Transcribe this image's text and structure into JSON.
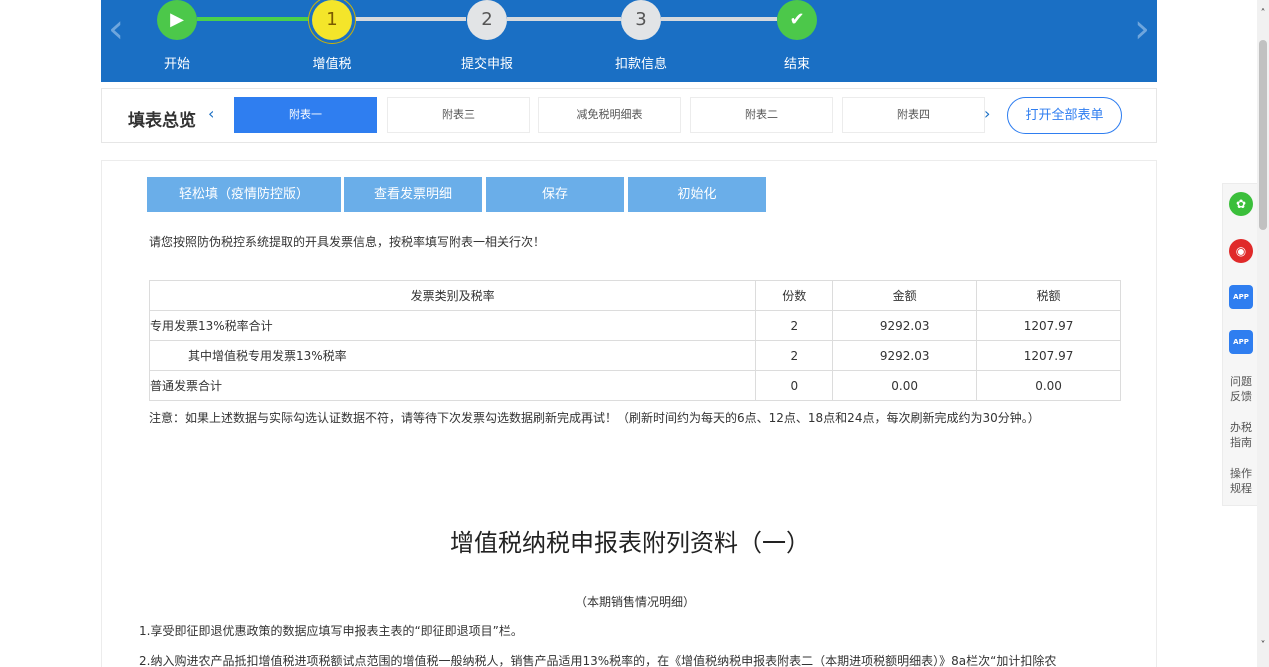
{
  "steps": [
    {
      "label": "开始",
      "marker": "▶",
      "status": "done"
    },
    {
      "label": "增值税",
      "marker": "1",
      "status": "current"
    },
    {
      "label": "提交申报",
      "marker": "2",
      "status": "pending"
    },
    {
      "label": "扣款信息",
      "marker": "3",
      "status": "pending"
    },
    {
      "label": "结束",
      "marker": "✔",
      "status": "done"
    }
  ],
  "nav": {
    "prev": "‹",
    "next": "›"
  },
  "tabs": {
    "title": "填表总览",
    "prev": "‹",
    "next": "›",
    "items": [
      "附表一",
      "附表三",
      "减免税明细表",
      "附表二",
      "附表四"
    ],
    "active_index": 0,
    "open_all": "打开全部表单"
  },
  "actions": [
    "轻松填（疫情防控版）",
    "查看发票明细",
    "保存",
    "初始化"
  ],
  "instruction": "请您按照防伪税控系统提取的开具发票信息，按税率填写附表一相关行次！",
  "table": {
    "headers": [
      "发票类别及税率",
      "份数",
      "金额",
      "税额"
    ],
    "rows": [
      {
        "category": "专用发票13%税率合计",
        "count": "2",
        "amount": "9292.03",
        "tax": "1207.97"
      },
      {
        "category": "其中增值税专用发票13%税率",
        "count": "2",
        "amount": "9292.03",
        "tax": "1207.97"
      },
      {
        "category": "普通发票合计",
        "count": "0",
        "amount": "0.00",
        "tax": "0.00"
      }
    ]
  },
  "note": "注意：如果上述数据与实际勾选认证数据不符，请等待下次发票勾选数据刷新完成再试！（刷新时间约为每天的6点、12点、18点和24点，每次刷新完成约为30分钟。）",
  "report": {
    "title": "增值税纳税申报表附列资料（一）",
    "subtitle": "（本期销售情况明细）",
    "rule_1": "1.享受即征即退优惠政策的数据应填写申报表主表的“即征即退项目”栏。",
    "rule_2": "2.纳入购进农产品抵扣增值税进项税额试点范围的增值税一般纳税人，销售产品适用13%税率的，在《增值税纳税申报表附表二（本期进项税额明细表）》8a栏次“加计扣除农"
  },
  "side_toolbar": {
    "icons": [
      "wechat-icon",
      "weibo-icon",
      "app-icon",
      "app-icon"
    ],
    "app_text": "APP",
    "links": [
      "问题反馈",
      "办税指南",
      "操作规程"
    ]
  },
  "colors": {
    "banner": "#1a6fc4",
    "active_tab": "#2f7ef0",
    "action_button": "#6aaee9",
    "done": "#4cc84a",
    "current": "#f4e52a"
  },
  "scroll": {
    "up": "˄",
    "down": "˅"
  }
}
